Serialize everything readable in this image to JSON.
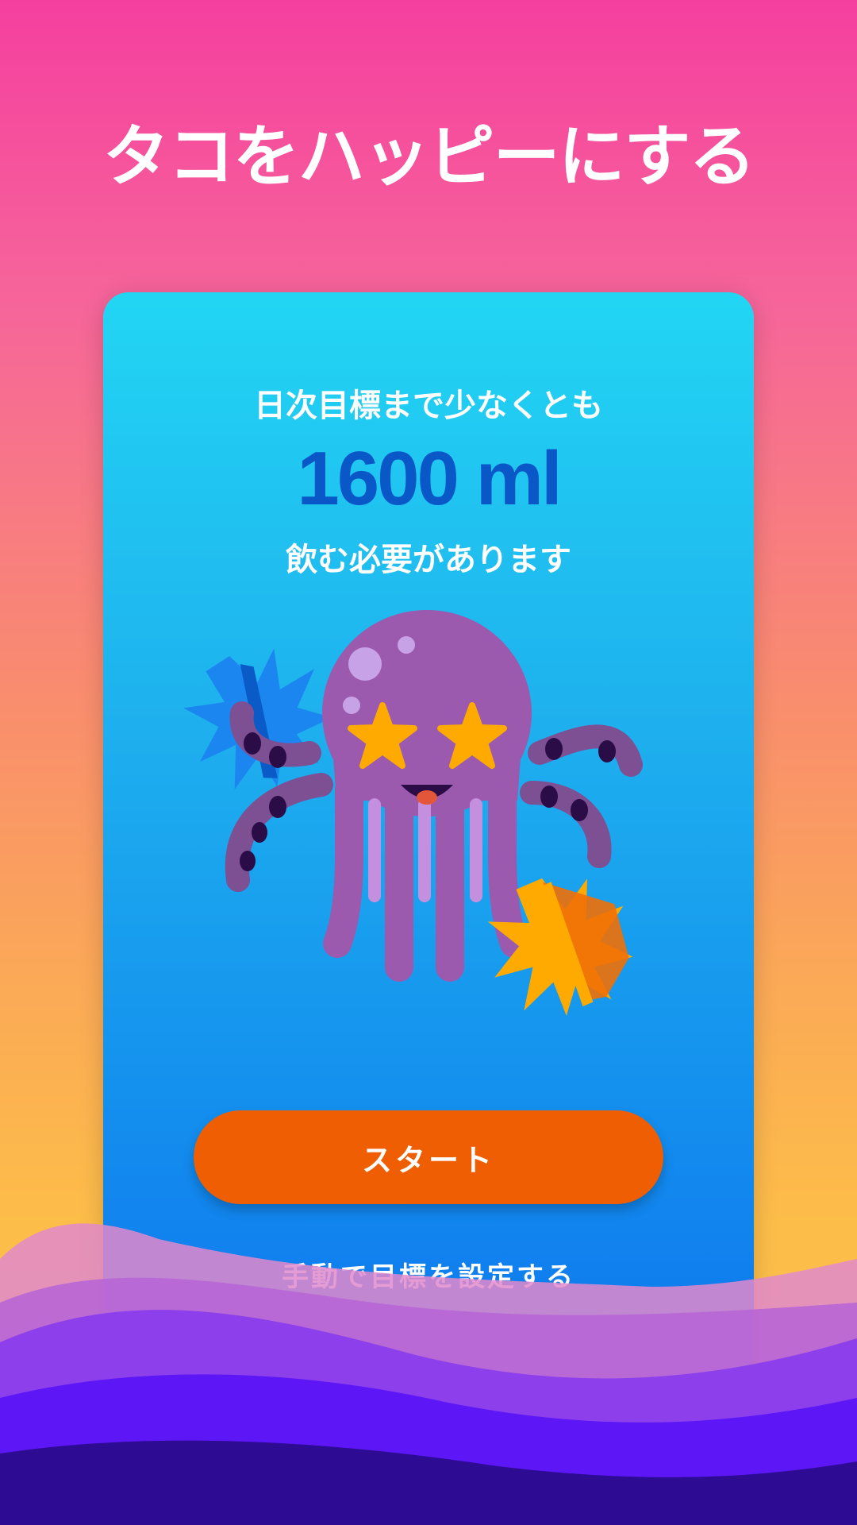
{
  "page": {
    "title": "タコをハッピーにする"
  },
  "goal": {
    "intro": "日次目標まで少なくとも",
    "value": "1600 ml",
    "outro": "飲む必要があります"
  },
  "actions": {
    "start_label": "スタート",
    "manual_label": "手動で目標を設定する"
  },
  "illustration": {
    "name": "octopus-mascot"
  },
  "colors": {
    "accent_button": "#F05E03",
    "goal_value": "#0A58C8",
    "card_top": "#22D6F3",
    "card_bottom": "#0B69ED"
  }
}
